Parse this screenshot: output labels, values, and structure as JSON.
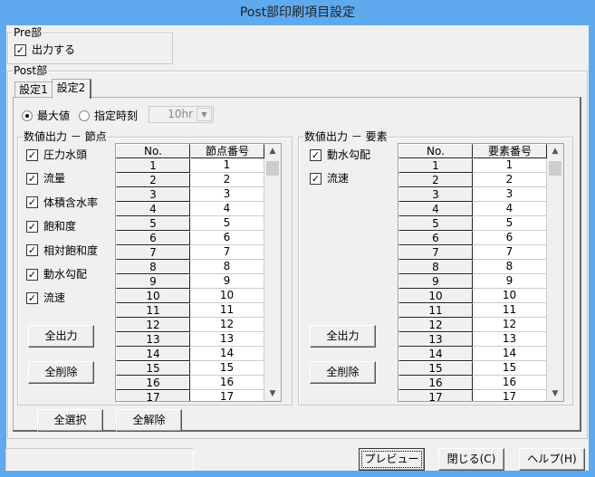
{
  "window": {
    "title": "Post部印刷項目設定"
  },
  "pre": {
    "label": "Pre部",
    "output_label": "出力する",
    "output_checked": true
  },
  "post": {
    "label": "Post部",
    "tabs": [
      {
        "label": "設定1"
      },
      {
        "label": "設定2"
      }
    ],
    "active_tab": 1
  },
  "time": {
    "max_label": "最大値",
    "specified_label": "指定時刻",
    "selected": "max",
    "time_value": "10hr"
  },
  "nodes": {
    "label": "数値出力 － 節点",
    "checks": [
      "圧力水頭",
      "流量",
      "体積含水率",
      "飽和度",
      "相対飽和度",
      "動水勾配",
      "流速"
    ],
    "all_out": "全出力",
    "all_del": "全削除",
    "col_no": "No.",
    "col_id": "節点番号",
    "rows": [
      1,
      2,
      3,
      4,
      5,
      6,
      7,
      8,
      9,
      10,
      11,
      12,
      13,
      14,
      15,
      16,
      17
    ]
  },
  "elements": {
    "label": "数値出力 － 要素",
    "checks": [
      "動水勾配",
      "流速"
    ],
    "all_out": "全出力",
    "all_del": "全削除",
    "col_no": "No.",
    "col_id": "要素番号",
    "rows": [
      1,
      2,
      3,
      4,
      5,
      6,
      7,
      8,
      9,
      10,
      11,
      12,
      13,
      14,
      15,
      16,
      17
    ]
  },
  "bottom": {
    "select_all": "全選択",
    "deselect_all": "全解除",
    "status": "",
    "preview": "プレビュー",
    "close": "閉じる(C)",
    "help": "ヘルプ(H)"
  }
}
